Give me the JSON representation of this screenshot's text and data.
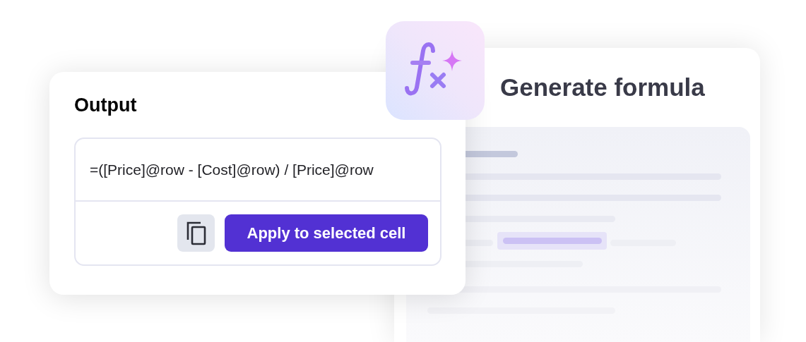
{
  "formula_panel": {
    "title": "Generate formula"
  },
  "output": {
    "title": "Output",
    "formula": "=([Price]@row - [Cost]@row) / [Price]@row",
    "apply_button": "Apply to selected cell"
  }
}
